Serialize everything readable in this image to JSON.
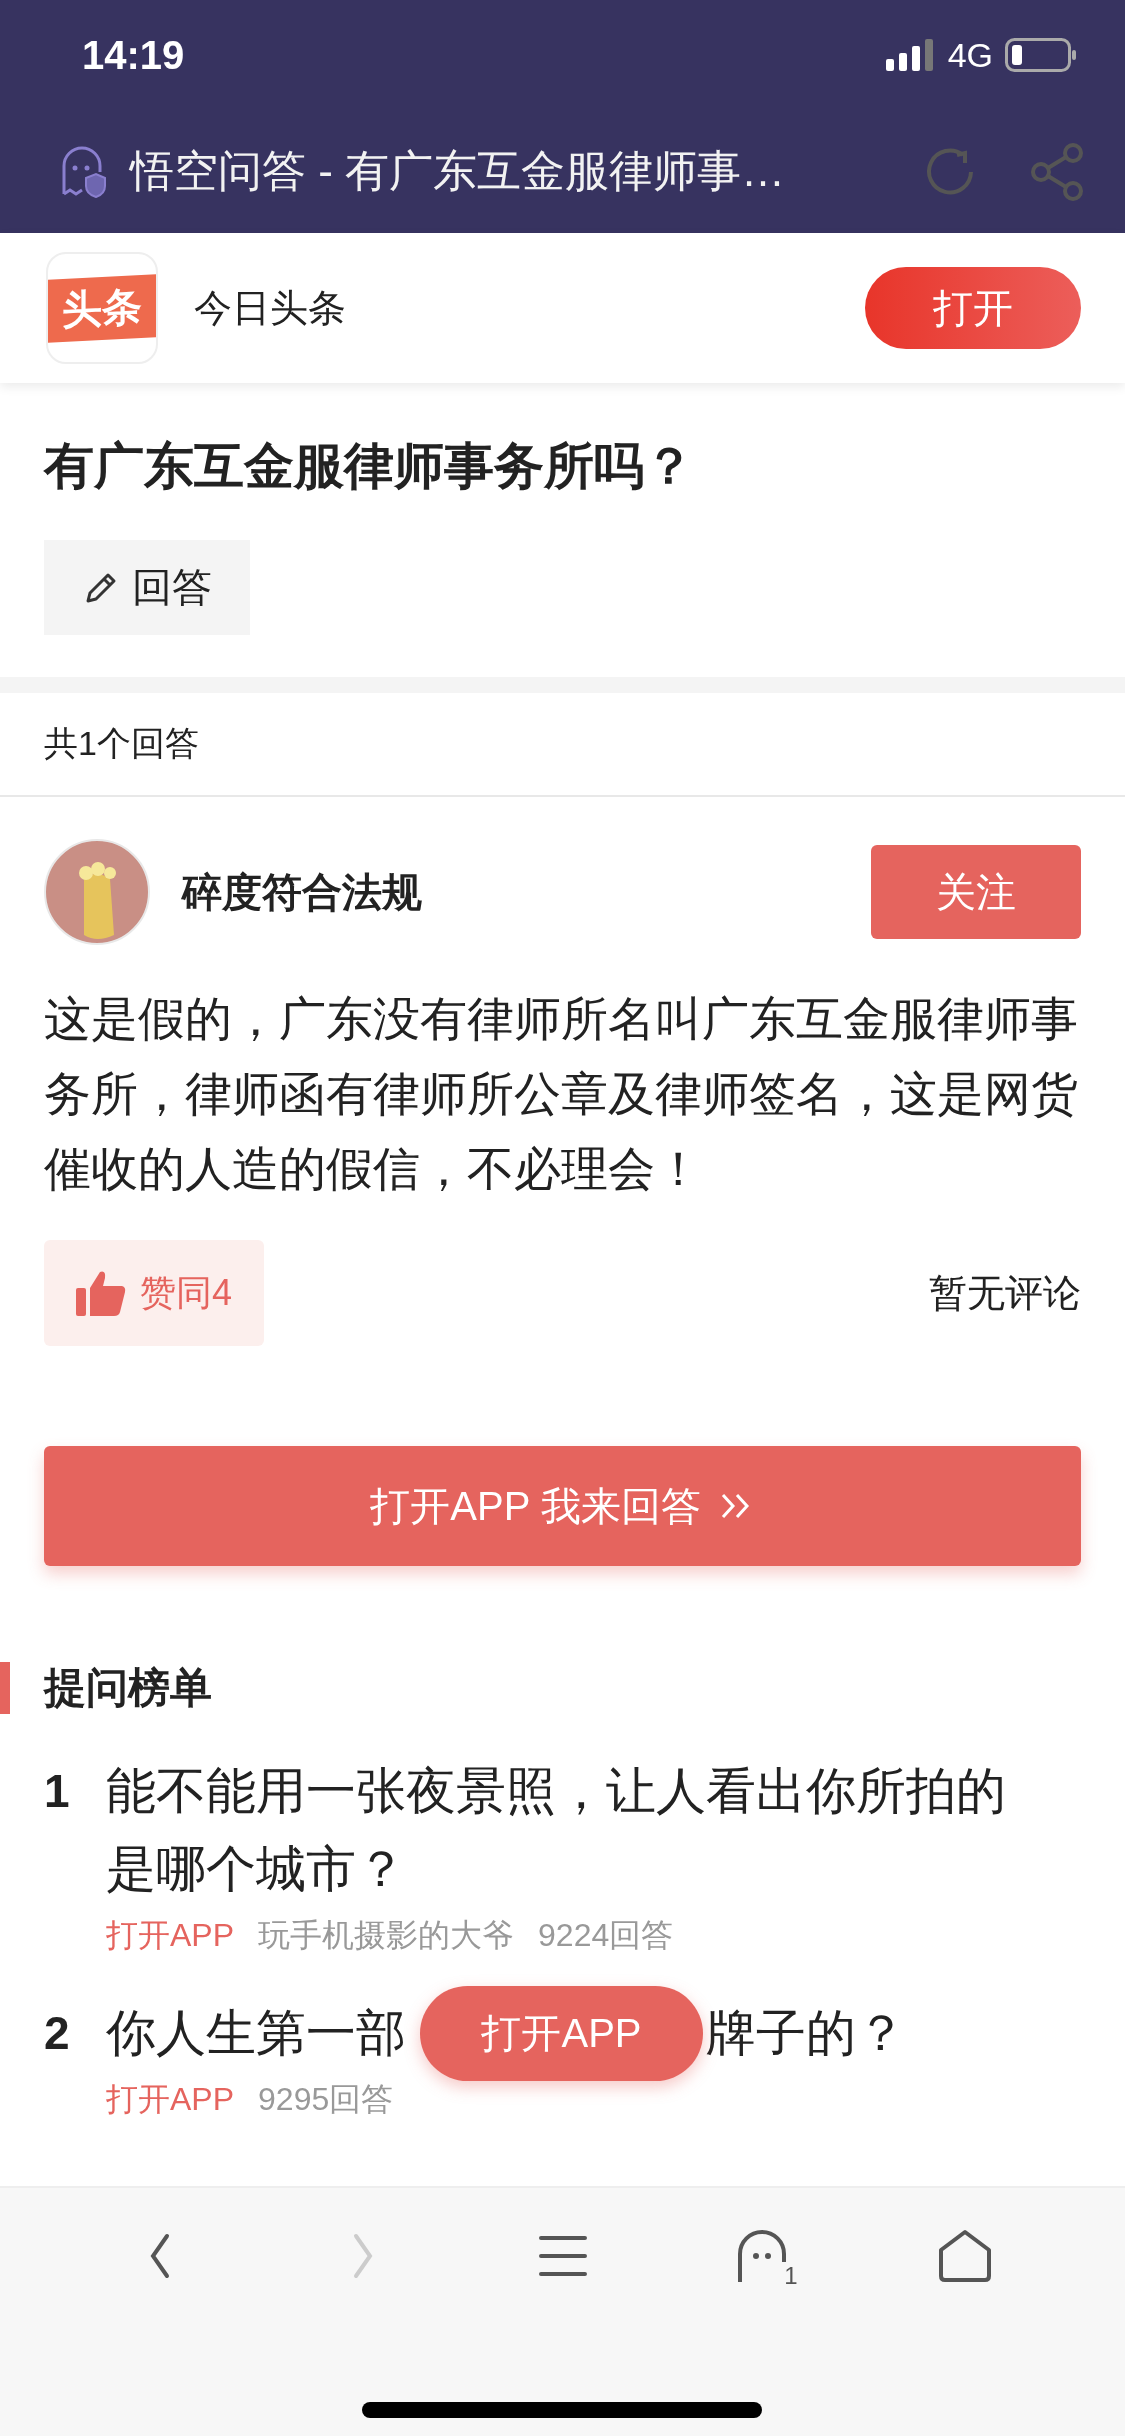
{
  "status_bar": {
    "time": "14:19",
    "network": "4G"
  },
  "browser_bar": {
    "title": "悟空问答 - 有广东互金服律师事…"
  },
  "app_banner": {
    "logo": "头条",
    "name": "今日头条",
    "open_button": "打开"
  },
  "question": {
    "title": "有广东互金服律师事务所吗？",
    "answer_button": "回答"
  },
  "answers_count": "共1个回答",
  "answer": {
    "author": "碎度符合法规",
    "follow_button": "关注",
    "text": "这是假的，广东没有律师所名叫广东互金服律师事务所，律师函有律师所公章及律师签名，这是网货催收的人造的假信，不必理会！",
    "like_button": "赞同4",
    "comments": "暂无评论"
  },
  "open_app_button": "打开APP 我来回答",
  "ranking": {
    "title": "提问榜单",
    "items": [
      {
        "rank": "1",
        "title_parts": [
          "能不能用一张夜景照，让人看出你所拍的是哪个城市？"
        ],
        "open_link": "打开APP",
        "author": "玩手机摄影的大爷",
        "answers": "9224回答"
      },
      {
        "rank": "2",
        "title_parts": [
          "你人生第一部",
          "牌子的？"
        ],
        "open_link": "打开APP",
        "answers": "9295回答"
      }
    ]
  },
  "floating_button": "打开APP",
  "bottom_toolbar": {
    "tab_count": "1"
  }
}
